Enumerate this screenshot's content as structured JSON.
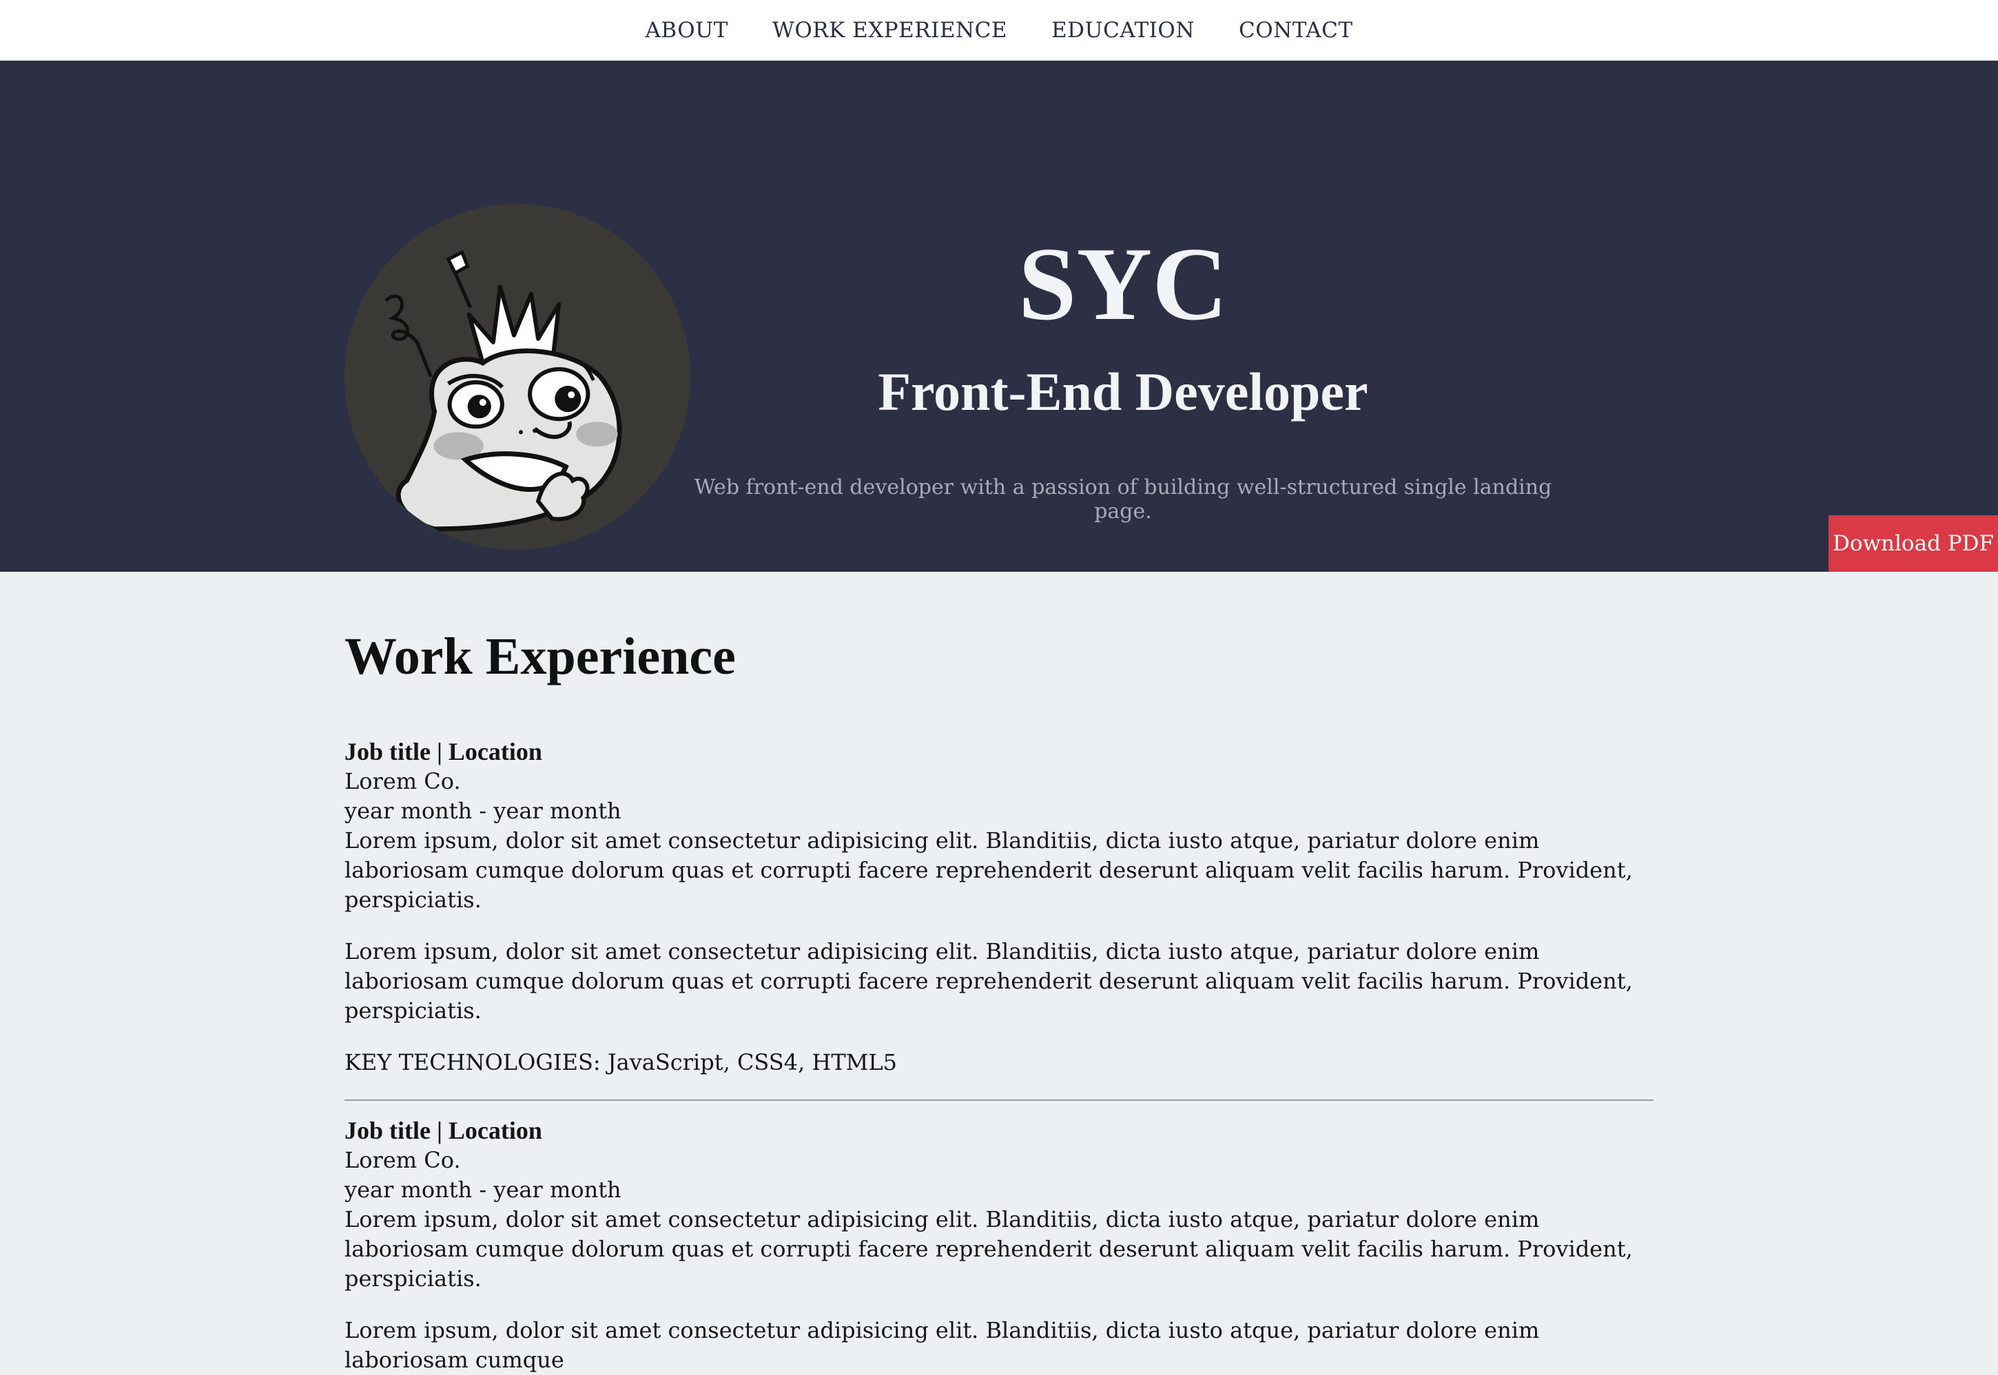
{
  "nav": {
    "items": [
      {
        "label": "ABOUT"
      },
      {
        "label": "WORK EXPERIENCE"
      },
      {
        "label": "EDUCATION"
      },
      {
        "label": "CONTACT"
      }
    ]
  },
  "hero": {
    "name": "SYC",
    "role": "Front-End Developer",
    "description": "Web front-end developer with a passion of building well-structured single landing page.",
    "download_label": "Download PDF"
  },
  "colors": {
    "hero_bg": "#2d3044",
    "page_bg": "#edf0f3",
    "accent": "#d93a45"
  },
  "work": {
    "title": "Work Experience",
    "jobs": [
      {
        "title": "Job title | Location",
        "company": "Lorem Co.",
        "dates": "year month - year month",
        "paragraphs": [
          "Lorem ipsum, dolor sit amet consectetur adipisicing elit. Blanditiis, dicta iusto atque, pariatur dolore enim laboriosam cumque dolorum quas et corrupti facere reprehenderit deserunt aliquam velit facilis harum. Provident, perspiciatis.",
          "Lorem ipsum, dolor sit amet consectetur adipisicing elit. Blanditiis, dicta iusto atque, pariatur dolore enim laboriosam cumque dolorum quas et corrupti facere reprehenderit deserunt aliquam velit facilis harum. Provident, perspiciatis."
        ],
        "tech": "KEY TECHNOLOGIES: JavaScript, CSS4, HTML5"
      },
      {
        "title": "Job title | Location",
        "company": "Lorem Co.",
        "dates": "year month - year month",
        "paragraphs": [
          "Lorem ipsum, dolor sit amet consectetur adipisicing elit. Blanditiis, dicta iusto atque, pariatur dolore enim laboriosam cumque dolorum quas et corrupti facere reprehenderit deserunt aliquam velit facilis harum. Provident, perspiciatis.",
          "Lorem ipsum, dolor sit amet consectetur adipisicing elit. Blanditiis, dicta iusto atque, pariatur dolore enim laboriosam cumque"
        ]
      }
    ]
  }
}
